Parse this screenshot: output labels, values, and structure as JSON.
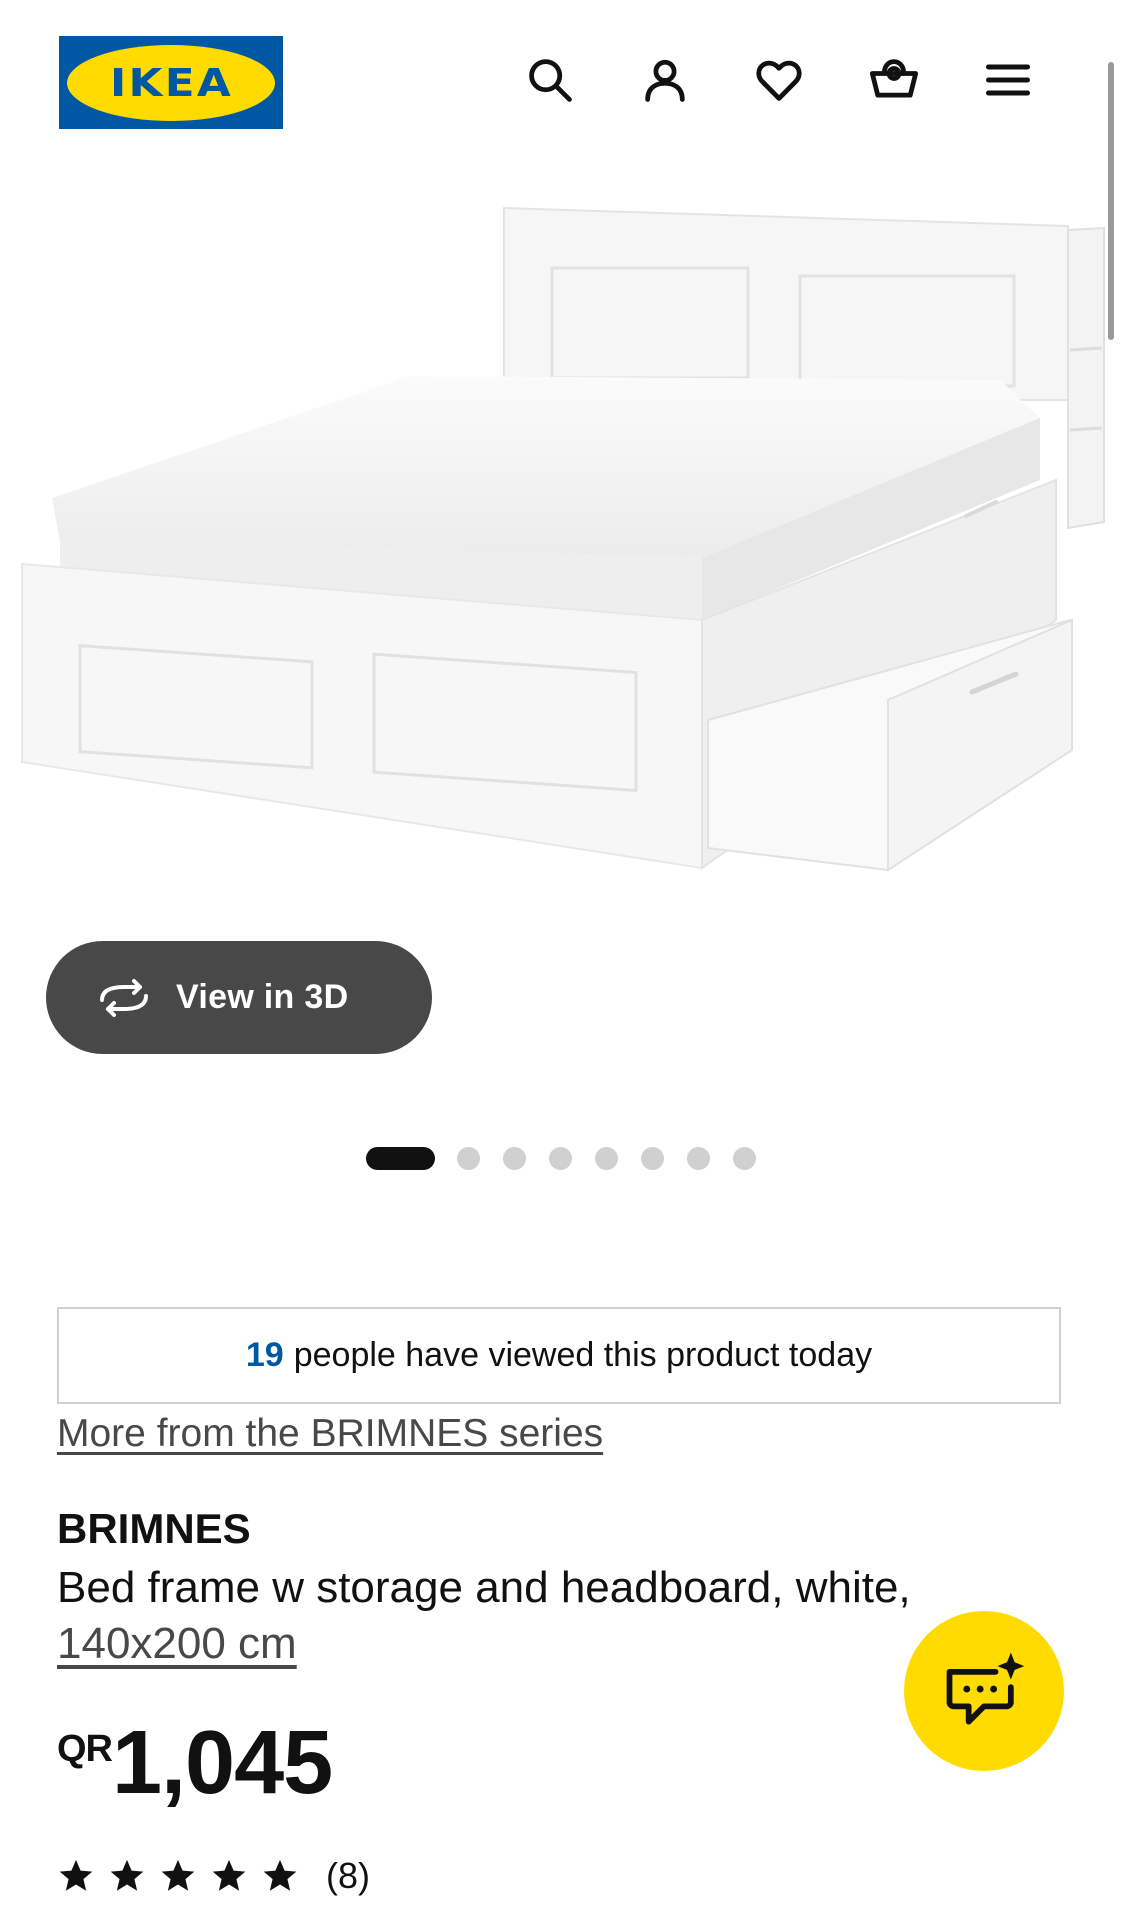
{
  "header": {
    "logo_text": "IKEA",
    "icons": [
      "search-icon",
      "account-icon",
      "heart-icon",
      "basket-icon",
      "menu-icon"
    ]
  },
  "gallery": {
    "view_3d_label": "View in 3D",
    "dots_total": 8,
    "active_dot": 1
  },
  "viewed": {
    "count": "19",
    "text": "people have viewed this product today"
  },
  "series_link": "More from the BRIMNES series",
  "product": {
    "name": "BRIMNES",
    "description": "Bed frame w storage and headboard, white,",
    "size": "140x200 cm",
    "currency": "QR",
    "price": "1,045",
    "rating_stars": 5,
    "review_count": "(8)"
  },
  "colors": {
    "ikea_blue": "#0058a3",
    "ikea_yellow": "#ffdb00",
    "button_dark": "#484848"
  }
}
